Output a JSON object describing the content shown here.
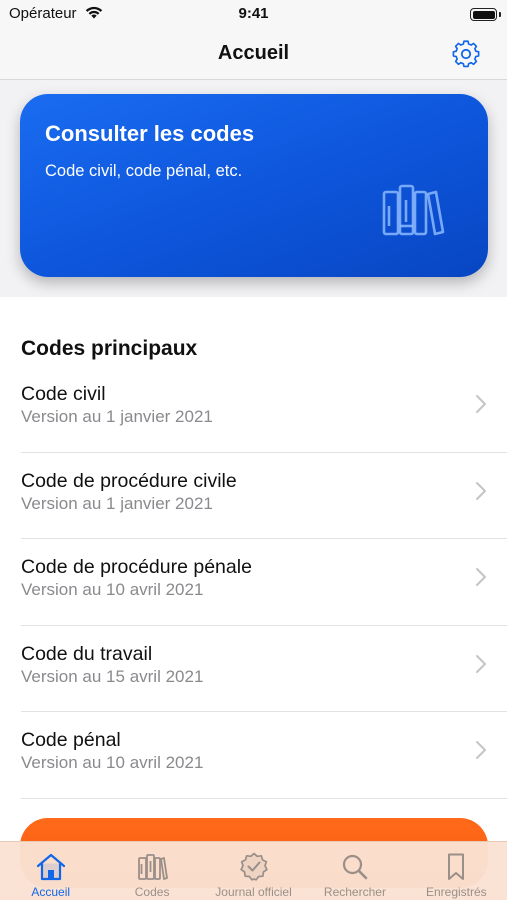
{
  "status_bar": {
    "carrier": "Opérateur",
    "time": "9:41"
  },
  "nav": {
    "title": "Accueil",
    "settings_icon": "gear-icon"
  },
  "hero": {
    "title": "Consulter les codes",
    "subtitle": "Code civil, code pénal, etc.",
    "icon": "books-icon"
  },
  "section": {
    "title": "Codes principaux"
  },
  "codes": [
    {
      "name": "Code civil",
      "version": "Version au 1 janvier 2021"
    },
    {
      "name": "Code de procédure civile",
      "version": "Version au 1 janvier 2021"
    },
    {
      "name": "Code de procédure pénale",
      "version": "Version au 10 avril 2021"
    },
    {
      "name": "Code du travail",
      "version": "Version au 15 avril 2021"
    },
    {
      "name": "Code pénal",
      "version": "Version au 10 avril 2021"
    }
  ],
  "tabs": [
    {
      "label": "Accueil",
      "icon": "house-icon",
      "active": true
    },
    {
      "label": "Codes",
      "icon": "books-icon",
      "active": false
    },
    {
      "label": "Journal officiel",
      "icon": "seal-check-icon",
      "active": false
    },
    {
      "label": "Rechercher",
      "icon": "search-icon",
      "active": false
    },
    {
      "label": "Enregistrés",
      "icon": "bookmark-icon",
      "active": false
    }
  ],
  "colors": {
    "accent": "#1266e8",
    "hero_card": "#0d55db",
    "orange_button": "#f65a0a",
    "tab_bar": "#fae2d2"
  }
}
